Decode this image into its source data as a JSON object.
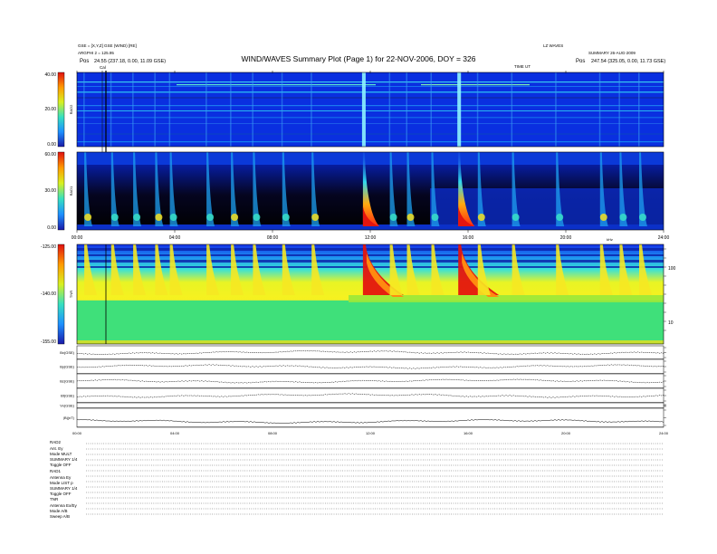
{
  "header": {
    "title": "WIND/WAVES Summary Plot (Page 1) for 22-NOV-2006, DOY = 326",
    "left_line1": "GSE = [X,Y,Z] GSE (WIND) [RE]",
    "left_line2": "ARGPHI 2 = 125.95",
    "left_pos_label": "Pos",
    "left_pos_value": "24.55 (237.18, 0.00, 11.09 GSE)",
    "right_line1": "LZ WAVES",
    "right_line2": "SUMMARY 26-AUG-2009",
    "right_pos_label": "Pos",
    "right_pos_value": "247.54 (325.05, 0.00, 11.73 GSE)",
    "ut_label": "TIME UT",
    "cal_label": "Cal"
  },
  "chart_data": [
    {
      "type": "heatmap",
      "ylabel": "RAD2",
      "yticks": [
        "40.00",
        "20.00",
        "0.00"
      ],
      "ylim": [
        0,
        40
      ]
    },
    {
      "type": "heatmap",
      "ylabel": "RAD1",
      "yticks": [
        "60.00",
        "30.00",
        "0.00"
      ],
      "ylim": [
        0,
        60
      ],
      "xticks": [
        "00:00",
        "04:00",
        "08:00",
        "12:00",
        "16:00",
        "20:00",
        "24:00"
      ]
    },
    {
      "type": "heatmap",
      "ylabel": "TNR",
      "yticks": [
        "-125.00",
        "-140.00",
        "-155.00"
      ],
      "right_ticks": [
        "100",
        "10"
      ],
      "right_label": "kHz",
      "ylim": [
        -155,
        -125
      ]
    },
    {
      "type": "line",
      "series": [
        {
          "name": "Bx(GSE)"
        },
        {
          "name": "By(GSE)"
        },
        {
          "name": "Bz(GSE)"
        },
        {
          "name": "Bt(GSE)"
        },
        {
          "name": "Vx(GSE)"
        },
        {
          "name": "|B|(nT)"
        }
      ],
      "xticks": [
        "00:00",
        "04:00",
        "08:00",
        "12:00",
        "16:00",
        "20:00",
        "24:00"
      ]
    }
  ],
  "bursts_hours": [
    0.3,
    1.4,
    2.3,
    3.2,
    3.8,
    5.3,
    6.3,
    7.2,
    8.4,
    9.6,
    11.7,
    12.8,
    13.5,
    14.5,
    15.6,
    16.4,
    17.8,
    19.6,
    21.4,
    22.2,
    23.0
  ],
  "strong_bursts_hours": [
    11.7,
    15.6
  ],
  "colors": {
    "background": "#0a2fe0",
    "rad1_background": "#000000",
    "tnr_band": "#3fe07a",
    "tnr_yellow": "#ffe600",
    "burst_red": "#e4150f"
  },
  "footer": {
    "rad2_title": "RAD2",
    "rad2_lines": [
      "Ant.      Ey",
      "Mode    MULT",
      "SUMMARY 1/4",
      "Toggle  OFF"
    ],
    "rad1_title": "RAD1",
    "rad1_lines": [
      "Antenna    Ey",
      "Mode    LIST p",
      "SUMMARY 1/4",
      "Toggle  OFF"
    ],
    "tnr_title": "TNR",
    "tnr_lines": [
      "Antenna   Ex/Ey",
      "Mode    A/B",
      "Sweep   A/B"
    ]
  }
}
